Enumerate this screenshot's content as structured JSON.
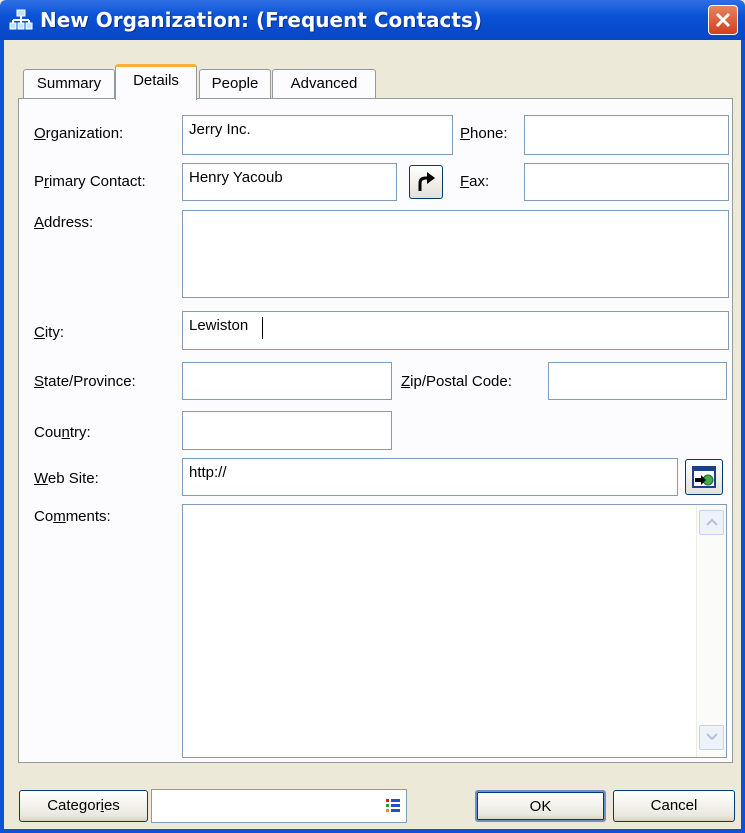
{
  "window": {
    "title": "New Organization:  (Frequent Contacts)"
  },
  "tabs": [
    {
      "label": "Summary",
      "active": false
    },
    {
      "label": "Details",
      "active": true
    },
    {
      "label": "People",
      "active": false
    },
    {
      "label": "Advanced",
      "active": false
    }
  ],
  "form": {
    "organization": {
      "mnemonic": "O",
      "rest": "rganization:",
      "value": "Jerry Inc."
    },
    "phone": {
      "mnemonic": "P",
      "rest": "hone:",
      "value": ""
    },
    "primary_contact": {
      "pre": "P",
      "mnemonic": "r",
      "rest": "imary Contact:",
      "value": "Henry Yacoub"
    },
    "fax": {
      "mnemonic": "F",
      "rest": "ax:",
      "value": ""
    },
    "address": {
      "mnemonic": "A",
      "rest": "ddress:",
      "value": ""
    },
    "city": {
      "mnemonic": "C",
      "rest": "ity:",
      "value": "Lewiston"
    },
    "state": {
      "mnemonic": "S",
      "rest": "tate/Province:",
      "value": ""
    },
    "zip": {
      "mnemonic": "Z",
      "rest": "ip/Postal Code:",
      "value": ""
    },
    "country": {
      "pre": "Cou",
      "mnemonic": "n",
      "rest": "try:",
      "value": ""
    },
    "website": {
      "mnemonic": "W",
      "rest": "eb Site:",
      "value": "http://"
    },
    "comments": {
      "pre": "Co",
      "mnemonic": "m",
      "rest": "ments:",
      "value": ""
    }
  },
  "footer": {
    "categories": {
      "pre": "Categor",
      "mnemonic": "i",
      "rest": "es"
    },
    "categories_value": "",
    "ok_label": "OK",
    "cancel_label": "Cancel"
  },
  "colors": {
    "titlebar": "#0a52d6",
    "dialog_bg": "#ece9d8",
    "active_tab_accent": "#f7b337",
    "field_border": "#7f9db9"
  },
  "icons": {
    "title": "organization-icon",
    "close": "close-icon",
    "contact_go": "curved-arrow-icon",
    "website_go": "browse-web-icon",
    "categories_list": "list-icon"
  }
}
